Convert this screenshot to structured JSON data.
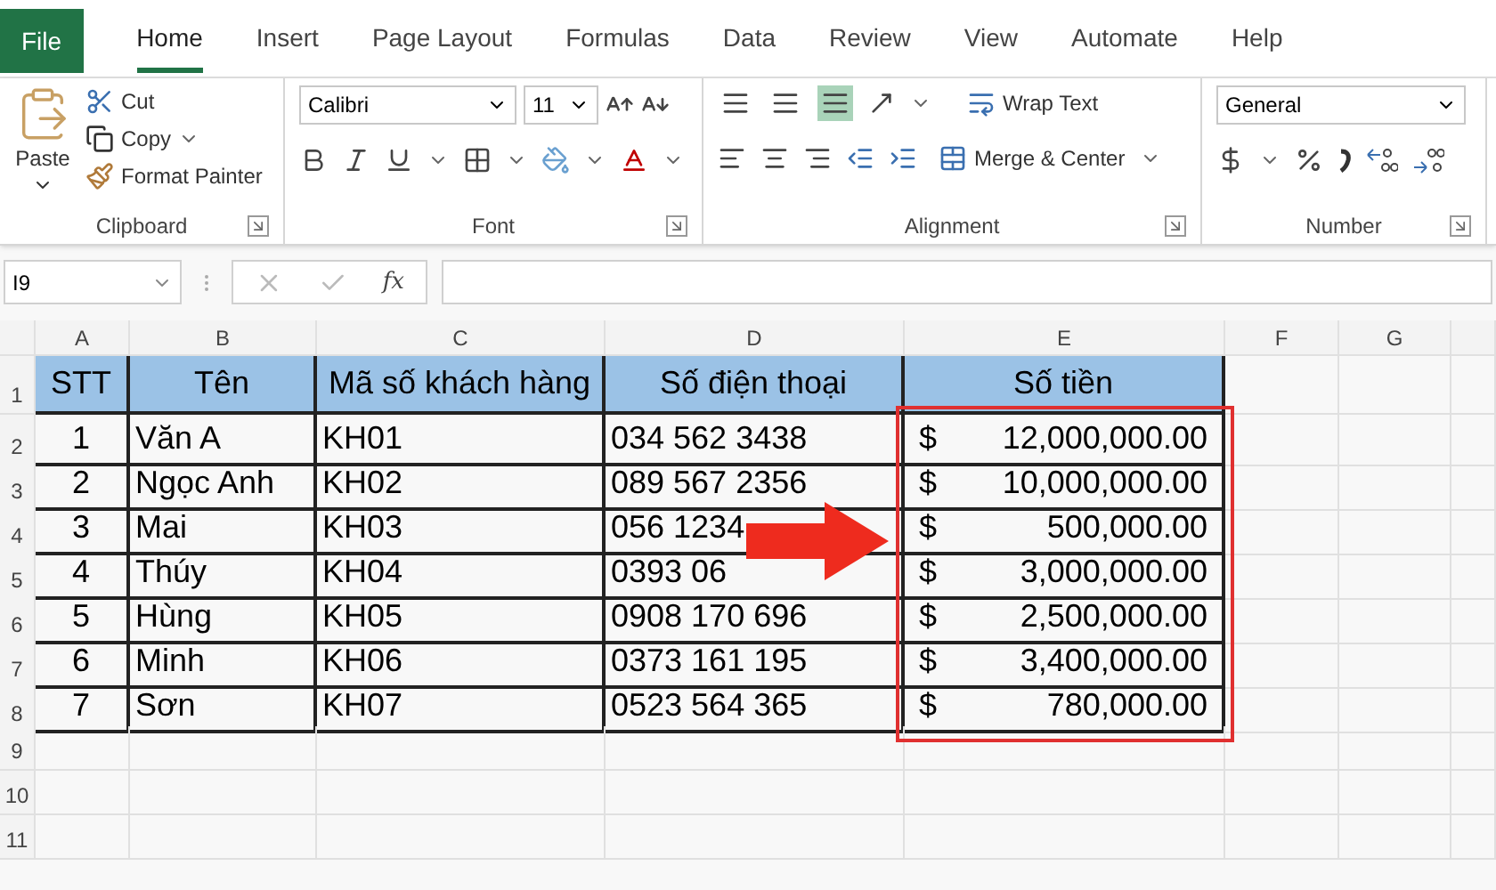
{
  "tabs": [
    {
      "label": "File",
      "kind": "file",
      "selected": false
    },
    {
      "label": "Home",
      "kind": "tab",
      "selected": true
    },
    {
      "label": "Insert",
      "kind": "tab",
      "selected": false
    },
    {
      "label": "Page Layout",
      "kind": "tab",
      "selected": false
    },
    {
      "label": "Formulas",
      "kind": "tab",
      "selected": false
    },
    {
      "label": "Data",
      "kind": "tab",
      "selected": false
    },
    {
      "label": "Review",
      "kind": "tab",
      "selected": false
    },
    {
      "label": "View",
      "kind": "tab",
      "selected": false
    },
    {
      "label": "Automate",
      "kind": "tab",
      "selected": false
    },
    {
      "label": "Help",
      "kind": "tab",
      "selected": false
    }
  ],
  "ribbon": {
    "clipboard": {
      "paste": "Paste",
      "cut": "Cut",
      "copy": "Copy",
      "format_painter": "Format Painter",
      "title": "Clipboard"
    },
    "font": {
      "name": "Calibri",
      "size": "11",
      "title": "Font"
    },
    "alignment": {
      "vertical": [
        {
          "selected": false
        },
        {
          "selected": false
        },
        {
          "selected": true
        }
      ],
      "wrap_text": "Wrap Text",
      "merge_center": "Merge & Center",
      "title": "Alignment"
    },
    "number": {
      "format": "General",
      "title": "Number"
    }
  },
  "formula_bar": {
    "name_box": "I9",
    "function_label": "fx"
  },
  "sheet": {
    "column_letters": [
      "A",
      "B",
      "C",
      "D",
      "E",
      "F",
      "G"
    ],
    "row_numbers": [
      "1",
      "2",
      "3",
      "4",
      "5",
      "6",
      "7",
      "8",
      "9",
      "10",
      "11"
    ],
    "columns": [
      "STT",
      "Tên",
      "Mã số khách hàng",
      "Số điện thoại",
      "Số tiền"
    ],
    "rows": [
      {
        "stt": "1",
        "name": "Văn A",
        "code": "KH01",
        "phone": "034 562 3438",
        "currency": "$",
        "amount": "12,000,000.00"
      },
      {
        "stt": "2",
        "name": "Ngọc Anh",
        "code": "KH02",
        "phone": "089 567 2356",
        "currency": "$",
        "amount": "10,000,000.00"
      },
      {
        "stt": "3",
        "name": "Mai",
        "code": "KH03",
        "phone": "056 1234",
        "currency": "$",
        "amount": "500,000.00"
      },
      {
        "stt": "4",
        "name": "Thúy",
        "code": "KH04",
        "phone": "0393 06",
        "currency": "$",
        "amount": "3,000,000.00"
      },
      {
        "stt": "5",
        "name": "Hùng",
        "code": "KH05",
        "phone": "0908 170 696",
        "currency": "$",
        "amount": "2,500,000.00"
      },
      {
        "stt": "6",
        "name": "Minh",
        "code": "KH06",
        "phone": "0373 161 195",
        "currency": "$",
        "amount": "3,400,000.00"
      },
      {
        "stt": "7",
        "name": "Sơn",
        "code": "KH07",
        "phone": "0523 564 365",
        "currency": "$",
        "amount": "780,000.00"
      }
    ]
  }
}
